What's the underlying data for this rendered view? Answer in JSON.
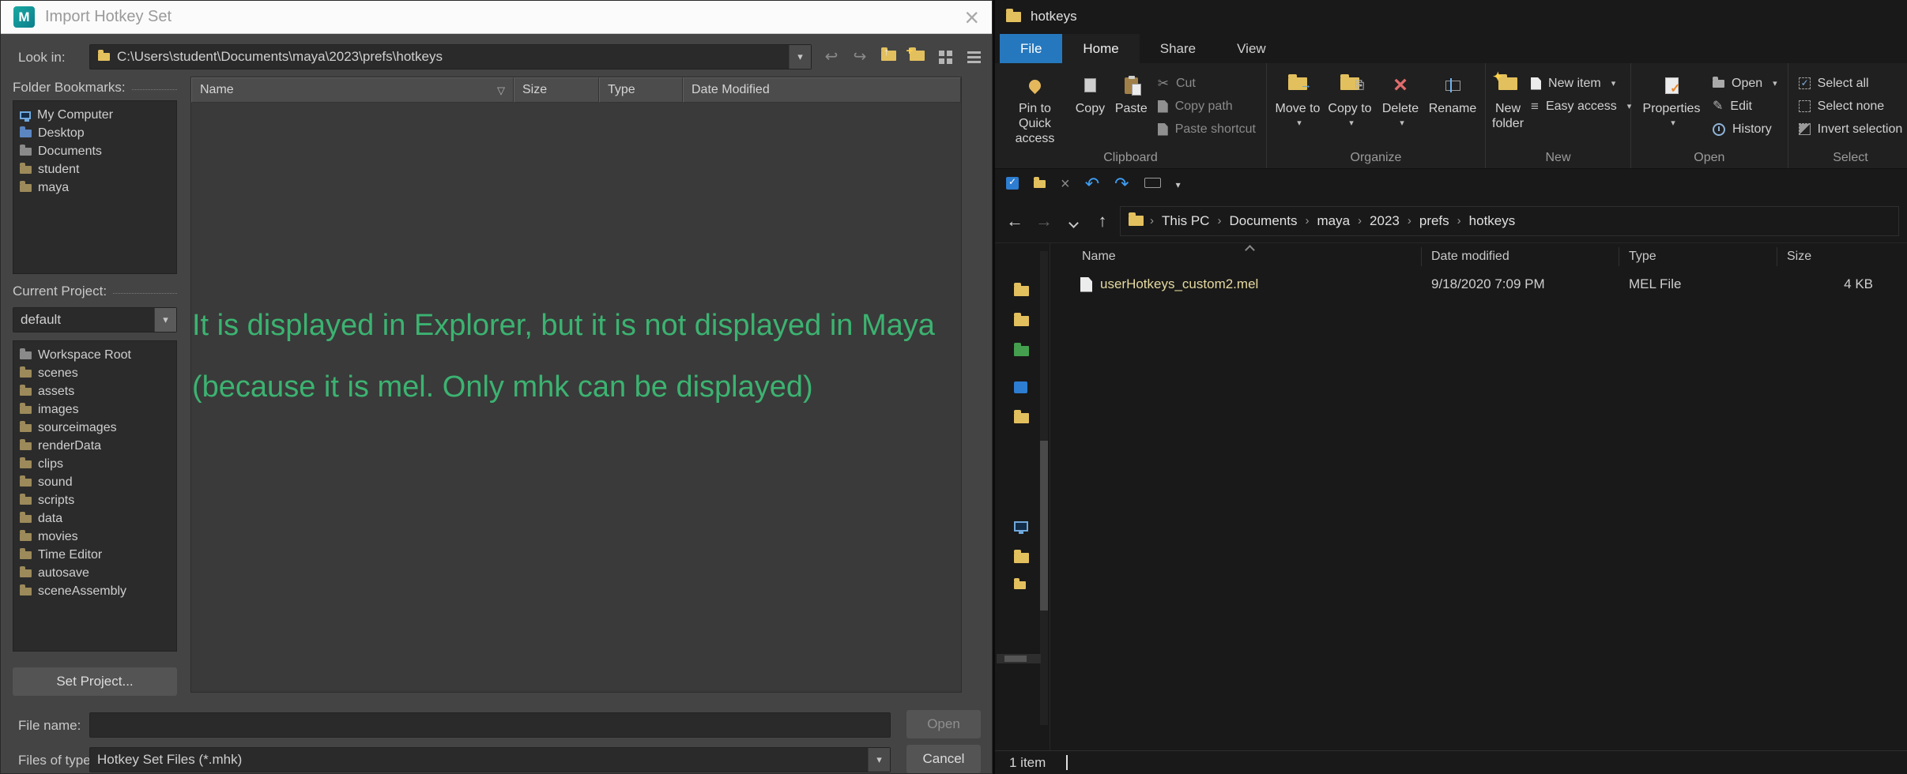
{
  "maya": {
    "window_title": "Import Hotkey Set",
    "close_glyph": "×",
    "look_in": {
      "label": "Look in:",
      "path": "C:\\Users\\student\\Documents\\maya\\2023\\prefs\\hotkeys"
    },
    "bookmarks": {
      "label": "Folder Bookmarks:",
      "items": [
        "My Computer",
        "Desktop",
        "Documents",
        "student",
        "maya"
      ]
    },
    "project": {
      "label": "Current Project:",
      "value": "default",
      "folders": [
        "Workspace Root",
        "scenes",
        "assets",
        "images",
        "sourceimages",
        "renderData",
        "clips",
        "sound",
        "scripts",
        "data",
        "movies",
        "Time Editor",
        "autosave",
        "sceneAssembly"
      ],
      "set_button": "Set Project..."
    },
    "columns": [
      "Name",
      "Size",
      "Type",
      "Date Modified"
    ],
    "annotation": {
      "text": "It is displayed in Explorer, but it is not displayed in Maya (because it is mel. Only mhk can be displayed)",
      "color": "#3cb371"
    },
    "file_name": {
      "label": "File name:",
      "value": ""
    },
    "files_of_type": {
      "label": "Files of type:",
      "value": "Hotkey Set Files (*.mhk)"
    },
    "open_label": "Open",
    "cancel_label": "Cancel"
  },
  "explorer": {
    "window_title": "hotkeys",
    "accent": {
      "file_tab": "#2678be"
    },
    "tabs": {
      "file": "File",
      "home": "Home",
      "share": "Share",
      "view": "View"
    },
    "ribbon": {
      "pin_to_quick_access": "Pin to Quick access",
      "copy": "Copy",
      "paste": "Paste",
      "cut": "Cut",
      "copy_path": "Copy path",
      "paste_shortcut": "Paste shortcut",
      "clipboard_group": "Clipboard",
      "move_to": "Move to",
      "copy_to": "Copy to",
      "delete": "Delete",
      "rename": "Rename",
      "organize_group": "Organize",
      "new_folder": "New folder",
      "new_item": "New item",
      "easy_access": "Easy access",
      "new_group": "New",
      "properties": "Properties",
      "open": "Open",
      "edit": "Edit",
      "history": "History",
      "open_group": "Open",
      "select_all": "Select all",
      "select_none": "Select none",
      "invert_selection": "Invert selection",
      "select_group": "Select"
    },
    "breadcrumb": [
      "This PC",
      "Documents",
      "maya",
      "2023",
      "prefs",
      "hotkeys"
    ],
    "columns": [
      "Name",
      "Date modified",
      "Type",
      "Size"
    ],
    "rows": [
      {
        "name": "userHotkeys_custom2.mel",
        "date_modified": "9/18/2020 7:09 PM",
        "type": "MEL File",
        "size": "4 KB"
      }
    ],
    "status": "1 item"
  }
}
